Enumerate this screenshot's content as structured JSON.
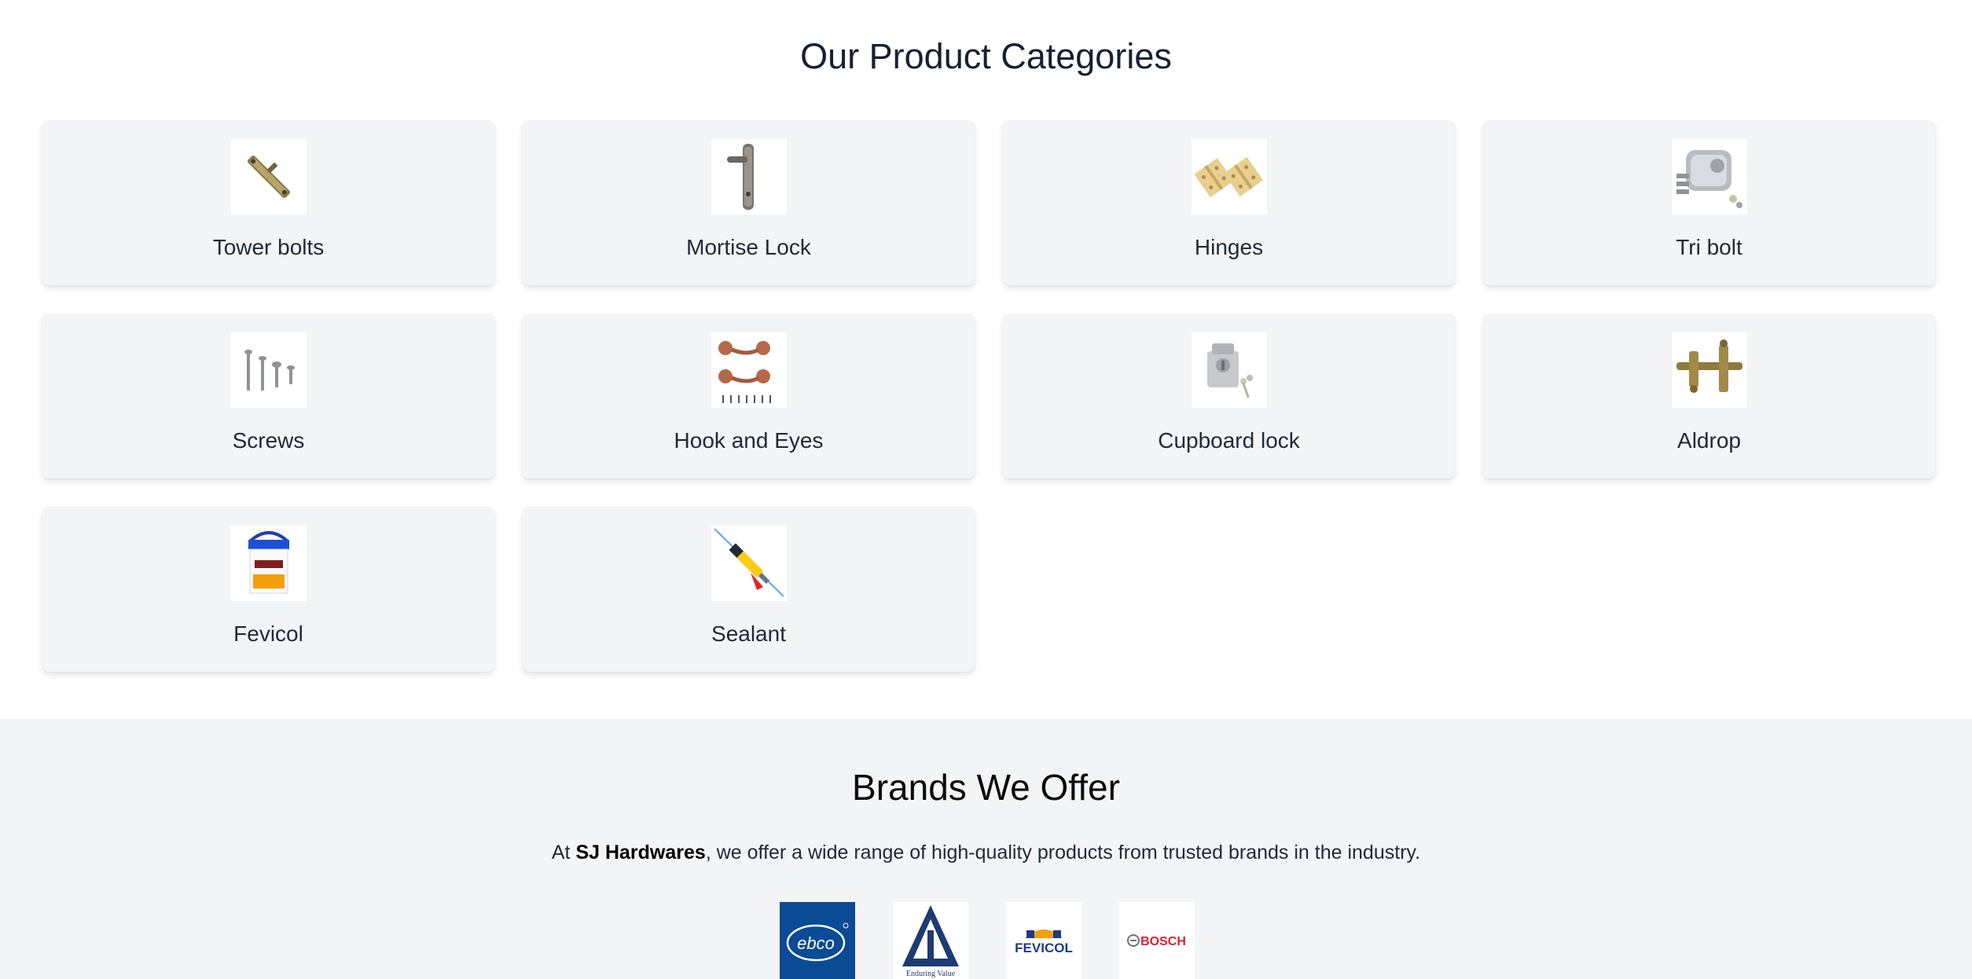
{
  "categories_section": {
    "title": "Our Product Categories",
    "items": [
      {
        "label": "Tower bolts",
        "icon": "tower-bolt-image"
      },
      {
        "label": "Mortise Lock",
        "icon": "mortise-lock-image"
      },
      {
        "label": "Hinges",
        "icon": "hinges-image"
      },
      {
        "label": "Tri bolt",
        "icon": "tri-bolt-image"
      },
      {
        "label": "Screws",
        "icon": "screws-image"
      },
      {
        "label": "Hook and Eyes",
        "icon": "hook-and-eyes-image"
      },
      {
        "label": "Cupboard lock",
        "icon": "cupboard-lock-image"
      },
      {
        "label": "Aldrop",
        "icon": "aldrop-image"
      },
      {
        "label": "Fevicol",
        "icon": "fevicol-image"
      },
      {
        "label": "Sealant",
        "icon": "sealant-image"
      }
    ]
  },
  "brands_section": {
    "title": "Brands We Offer",
    "desc_prefix": "At ",
    "desc_brand": "SJ Hardwares",
    "desc_suffix": ", we offer a wide range of high-quality products from trusted brands in the industry.",
    "logos": [
      {
        "name": "ebco-logo",
        "text": "ebco"
      },
      {
        "name": "itc-logo",
        "text": "Enduring Value"
      },
      {
        "name": "fevicol-logo",
        "text": "FEVICOL"
      },
      {
        "name": "bosch-logo",
        "text": "BOSCH"
      }
    ]
  },
  "colors": {
    "background": "#ffffff",
    "card": "#f3f4f6",
    "brands_bg": "#f3f4f6",
    "ebco_blue": "#0b4a95",
    "bosch_red": "#e11d2a",
    "fevicol_blue": "#1e3a8a"
  }
}
